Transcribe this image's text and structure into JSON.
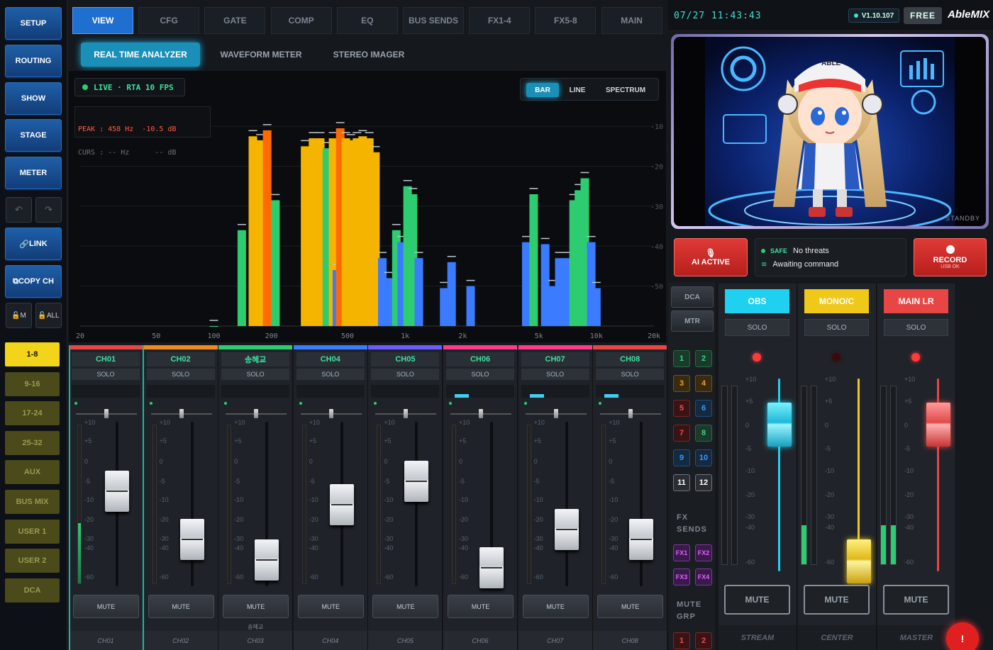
{
  "left_nav": {
    "buttons": [
      "SETUP",
      "ROUTING",
      "SHOW",
      "STAGE",
      "METER"
    ],
    "undo_icon": "undo-icon",
    "redo_icon": "redo-icon",
    "link": "LINK",
    "copy": "COPY CH",
    "m": "M",
    "all": "ALL",
    "banks": [
      "1-8",
      "9-16",
      "17-24",
      "25-32",
      "AUX",
      "BUS MIX",
      "USER 1",
      "USER 2",
      "DCA"
    ]
  },
  "tabs": [
    "VIEW",
    "CFG",
    "GATE",
    "COMP",
    "EQ",
    "BUS SENDS",
    "FX1-4",
    "FX5-8",
    "MAIN"
  ],
  "subtabs": [
    "REAL TIME ANALYZER",
    "WAVEFORM METER",
    "STEREO IMAGER"
  ],
  "rta": {
    "live": "LIVE · RTA 10 FPS",
    "modes": [
      "BAR",
      "LINE",
      "SPECTRUM"
    ],
    "peak": "PEAK : 458 Hz  -10.5 dB",
    "curs": "CURS : -- Hz      -- dB",
    "db_ticks": [
      "-10",
      "-20",
      "-30",
      "-40",
      "-50"
    ],
    "freq_ticks": [
      "20",
      "50",
      "100",
      "200",
      "500",
      "1k",
      "2k",
      "5k",
      "10k",
      "20k"
    ]
  },
  "chart_data": {
    "type": "bar",
    "title": "",
    "xlabel": "Frequency (Hz)",
    "ylabel": "dB",
    "x_ticks": [
      "20",
      "50",
      "100",
      "200",
      "500",
      "1k",
      "2k",
      "5k",
      "10k",
      "20k"
    ],
    "y_ticks": [
      -10,
      -20,
      -30,
      -40,
      -50
    ],
    "ylim": [
      -60,
      -5
    ],
    "bars": [
      {
        "x": 100,
        "y": -60,
        "c": "#2ecc71"
      },
      {
        "x": 140,
        "y": -36,
        "c": "#2ecc71"
      },
      {
        "x": 160,
        "y": -12.5,
        "c": "#f4b400"
      },
      {
        "x": 175,
        "y": -13.5,
        "c": "#f4b400"
      },
      {
        "x": 190,
        "y": -11,
        "c": "#ff6a00"
      },
      {
        "x": 210,
        "y": -28.5,
        "c": "#2ecc71"
      },
      {
        "x": 300,
        "y": -15,
        "c": "#f4b400"
      },
      {
        "x": 330,
        "y": -13,
        "c": "#f4b400"
      },
      {
        "x": 360,
        "y": -13,
        "c": "#f4b400"
      },
      {
        "x": 390,
        "y": -15.5,
        "c": "#2ecc71"
      },
      {
        "x": 420,
        "y": -13,
        "c": "#f4b400"
      },
      {
        "x": 440,
        "y": -46,
        "c": "#3a7bff"
      },
      {
        "x": 458,
        "y": -10.5,
        "c": "#ff6a00"
      },
      {
        "x": 490,
        "y": -13,
        "c": "#f4b400"
      },
      {
        "x": 520,
        "y": -13.5,
        "c": "#f4b400"
      },
      {
        "x": 560,
        "y": -13,
        "c": "#f4b400"
      },
      {
        "x": 600,
        "y": -12.5,
        "c": "#f4b400"
      },
      {
        "x": 650,
        "y": -13,
        "c": "#f4b400"
      },
      {
        "x": 700,
        "y": -16.5,
        "c": "#f4b400"
      },
      {
        "x": 760,
        "y": -43,
        "c": "#3a7bff"
      },
      {
        "x": 820,
        "y": -48,
        "c": "#3a7bff"
      },
      {
        "x": 900,
        "y": -36,
        "c": "#2ecc71"
      },
      {
        "x": 960,
        "y": -39,
        "c": "#3a7bff"
      },
      {
        "x": 1030,
        "y": -25,
        "c": "#2ecc71"
      },
      {
        "x": 1100,
        "y": -27,
        "c": "#2ecc71"
      },
      {
        "x": 1180,
        "y": -43,
        "c": "#3a7bff"
      },
      {
        "x": 1600,
        "y": -50.5,
        "c": "#3a7bff"
      },
      {
        "x": 1750,
        "y": -44,
        "c": "#3a7bff"
      },
      {
        "x": 2200,
        "y": -50,
        "c": "#3a7bff"
      },
      {
        "x": 4300,
        "y": -39,
        "c": "#3a7bff"
      },
      {
        "x": 4700,
        "y": -27,
        "c": "#2ecc71"
      },
      {
        "x": 5400,
        "y": -39.5,
        "c": "#3a7bff"
      },
      {
        "x": 5900,
        "y": -50,
        "c": "#3a7bff"
      },
      {
        "x": 6400,
        "y": -43,
        "c": "#3a7bff"
      },
      {
        "x": 7000,
        "y": -43,
        "c": "#3a7bff"
      },
      {
        "x": 7600,
        "y": -28.5,
        "c": "#2ecc71"
      },
      {
        "x": 8100,
        "y": -26,
        "c": "#2ecc71"
      },
      {
        "x": 8700,
        "y": -23,
        "c": "#2ecc71"
      },
      {
        "x": 9400,
        "y": -39,
        "c": "#3a7bff"
      },
      {
        "x": 10000,
        "y": -50.5,
        "c": "#3a7bff"
      }
    ]
  },
  "channels": [
    {
      "name": "CH01",
      "color": "#e84545",
      "fader": -2.5,
      "meter": 0.38,
      "pan": 0.5,
      "gr": 0,
      "foot": "CH01"
    },
    {
      "name": "CH02",
      "color": "#f08a1a",
      "fader": -20,
      "meter": 0,
      "pan": 0.5,
      "gr": 0,
      "foot": "CH02"
    },
    {
      "name": "송혜교",
      "color": "#2ecc71",
      "fader": -32,
      "meter": 0,
      "pan": 0.5,
      "gr": 0,
      "foot": "CH03",
      "sub": "송혜교"
    },
    {
      "name": "CH04",
      "color": "#3a7bff",
      "fader": -6,
      "meter": 0,
      "pan": 0.5,
      "gr": 0,
      "foot": "CH04"
    },
    {
      "name": "CH05",
      "color": "#6a5cff",
      "fader": 0,
      "meter": 0,
      "pan": 0.5,
      "gr": 0,
      "foot": "CH05"
    },
    {
      "name": "CH06",
      "color": "#ff3a8c",
      "fader": -40,
      "meter": 0,
      "pan": 0.5,
      "gr": 0.3,
      "foot": "CH06"
    },
    {
      "name": "CH07",
      "color": "#ff3a8c",
      "fader": -15,
      "meter": 0,
      "pan": 0.5,
      "gr": 0.3,
      "foot": "CH07"
    },
    {
      "name": "CH08",
      "color": "#e84545",
      "fader": -20,
      "meter": 0,
      "pan": 0.5,
      "gr": 0.3,
      "foot": "CH08"
    }
  ],
  "strip_labels": {
    "solo": "SOLO",
    "mute": "MUTE",
    "scale": [
      "+10",
      "+5",
      "0",
      "-5",
      "-10",
      "-20",
      "-30",
      "-40",
      "-60"
    ]
  },
  "header": {
    "datetime": "07/27 11:43:43",
    "version": "V1.10.107",
    "plan": "FREE",
    "brand": "AbleMIX"
  },
  "preview": {
    "standby": "STANDBY",
    "avatar_label": "ABLE"
  },
  "ai": {
    "label": "AI ACTIVE",
    "safe": "SAFE",
    "threats": "No threats",
    "await": "Awaiting command",
    "record": "RECORD",
    "usb": "USB OK"
  },
  "dca": {
    "dca": "DCA",
    "mtr": "MTR",
    "nums": [
      "1",
      "2",
      "3",
      "4",
      "5",
      "6",
      "7",
      "8",
      "9",
      "10",
      "11",
      "12"
    ],
    "fx_sends": "FX\nSENDS",
    "fx": [
      "FX1",
      "FX2",
      "FX3",
      "FX4"
    ],
    "mute_grp": "MUTE\nGRP",
    "mgrp": [
      "1",
      "2"
    ]
  },
  "buses": [
    {
      "label": "OBS",
      "foot": "STREAM",
      "fader": 0
    },
    {
      "label": "MONO/C",
      "foot": "CENTER",
      "fader": -60
    },
    {
      "label": "MAIN LR",
      "foot": "MASTER",
      "fader": 0
    }
  ],
  "alert": "!"
}
